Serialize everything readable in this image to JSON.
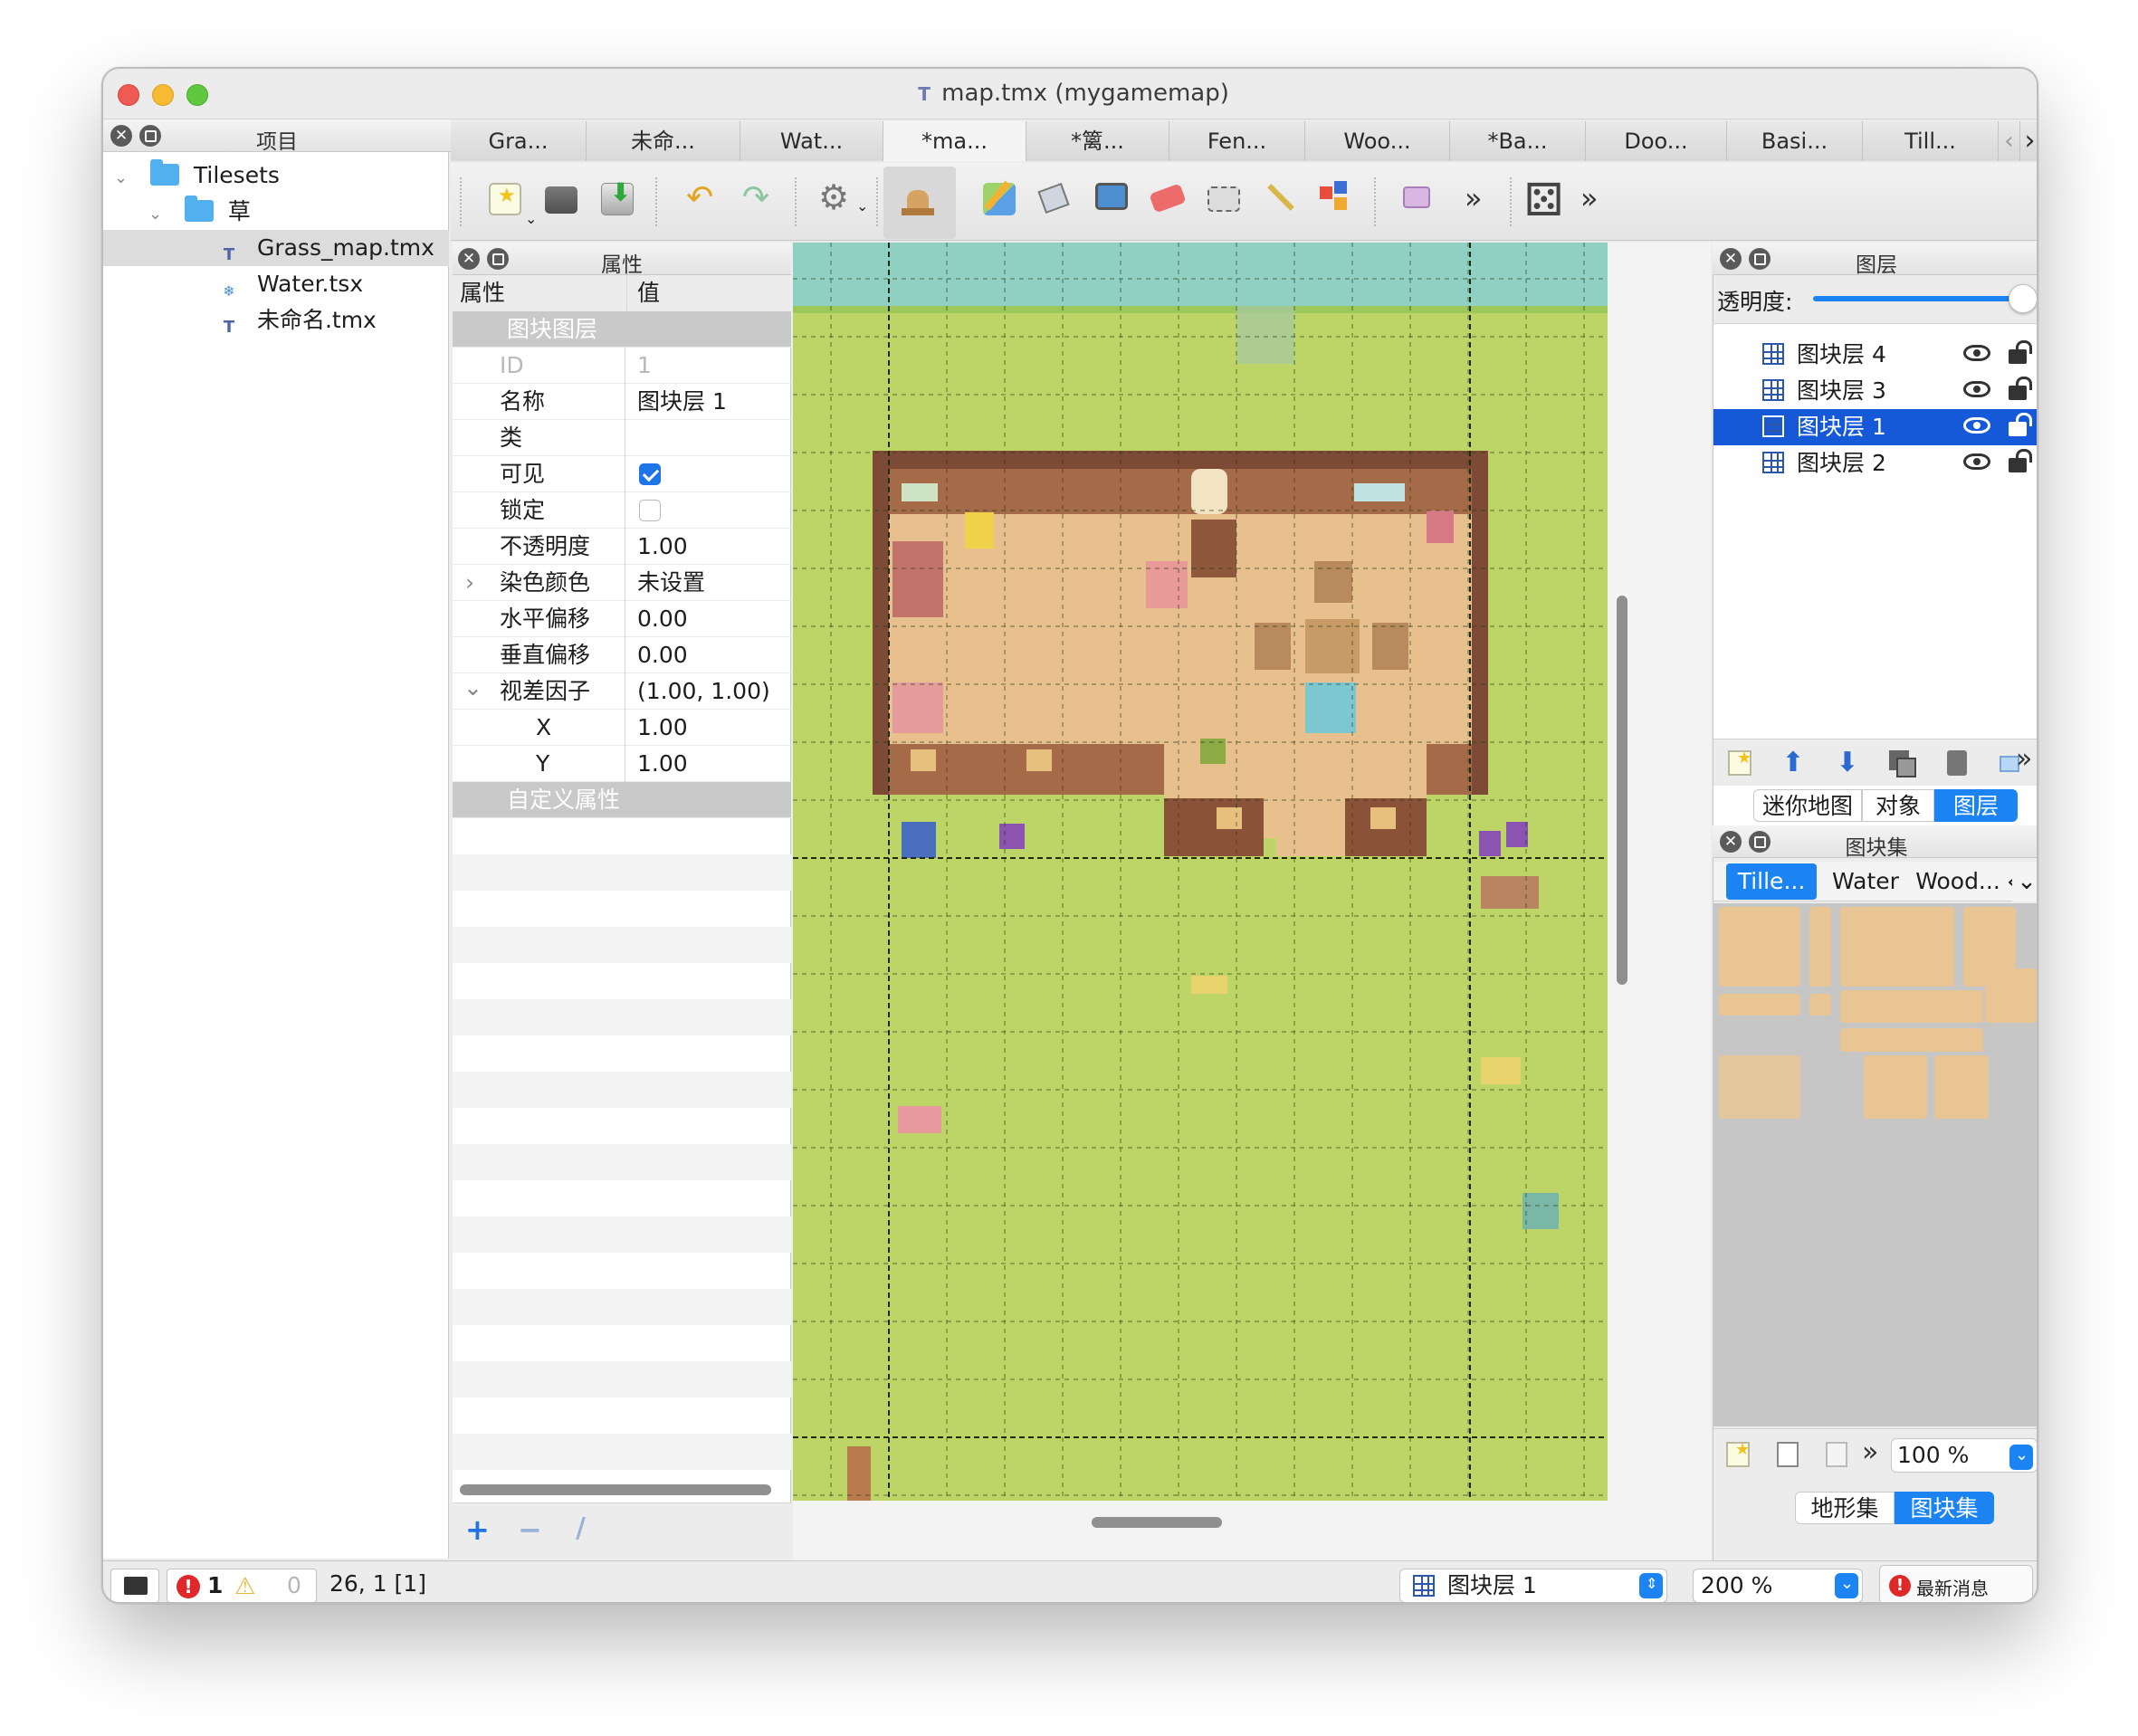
{
  "window": {
    "title": "map.tmx (mygamemap)"
  },
  "project_panel": {
    "title": "项目",
    "items": [
      {
        "label": "Tilesets",
        "kind": "folder"
      },
      {
        "label": "草",
        "kind": "folder"
      },
      {
        "label": "Grass_map.tmx",
        "kind": "tmx",
        "selected": true
      },
      {
        "label": "Water.tsx",
        "kind": "tsx"
      },
      {
        "label": "未命名.tmx",
        "kind": "tmx"
      }
    ]
  },
  "doc_tabs": [
    "Gra...",
    "未命...",
    "Wat...",
    "*ma...",
    "*篱...",
    "Fen...",
    "Woo...",
    "*Ba...",
    "Doo...",
    "Basi...",
    "Till..."
  ],
  "toolbar": {
    "tools": [
      "new-map-icon",
      "open-icon",
      "save-icon",
      "undo-icon",
      "redo-icon",
      "command-gear-icon",
      "stamp-brush-icon",
      "terrain-brush-icon",
      "bucket-fill-icon",
      "shape-fill-icon",
      "eraser-icon",
      "rect-select-icon",
      "magic-wand-icon",
      "select-same-tile-icon",
      "world-tool-icon",
      "more-icon",
      "random-mode-icon",
      "more-icon-2"
    ]
  },
  "properties_panel": {
    "title": "属性",
    "col_key": "属性",
    "col_value": "值",
    "group1": "图块图层",
    "rows": [
      {
        "key": "ID",
        "value": "1",
        "disabled": true
      },
      {
        "key": "名称",
        "value": "图块层 1"
      },
      {
        "key": "类",
        "value": ""
      },
      {
        "key": "可见",
        "value": "",
        "checkbox": true,
        "checked": true
      },
      {
        "key": "锁定",
        "value": "",
        "checkbox": true,
        "checked": false
      },
      {
        "key": "不透明度",
        "value": "1.00"
      },
      {
        "key": "染色颜色",
        "value": "未设置",
        "expander": "›"
      },
      {
        "key": "水平偏移",
        "value": "0.00"
      },
      {
        "key": "垂直偏移",
        "value": "0.00"
      },
      {
        "key": "视差因子",
        "value": "(1.00, 1.00)",
        "expander": "⌄"
      },
      {
        "key": "X",
        "value": "1.00",
        "indent": true
      },
      {
        "key": "Y",
        "value": "1.00",
        "indent": true
      }
    ],
    "group2": "自定义属性",
    "footer": {
      "add": "+",
      "remove": "−",
      "rename": "/"
    }
  },
  "layers_panel": {
    "title": "图层",
    "opacity_label": "透明度:",
    "opacity_value": 1.0,
    "layers": [
      {
        "name": "图块层 4",
        "selected": false
      },
      {
        "name": "图块层 3",
        "selected": false
      },
      {
        "name": "图块层 1",
        "selected": true
      },
      {
        "name": "图块层 2",
        "selected": false
      }
    ],
    "tabs": [
      "迷你地图",
      "对象",
      "图层"
    ],
    "active_tab": "图层"
  },
  "tilesets_panel": {
    "title": "图块集",
    "tabs": [
      "Tille...",
      "Water",
      "Wood..."
    ],
    "active_tab": "Tille...",
    "zoom": "100 %",
    "bottom_tabs": [
      "地形集",
      "图块集"
    ],
    "active_bottom_tab": "图块集"
  },
  "status_bar": {
    "errors": "1",
    "warnings": "0",
    "coords": "26, 1 [1]",
    "layer_select": "图块层 1",
    "zoom_select": "200 %",
    "news": "最新消息"
  },
  "colors": {
    "selection": "#1659d8",
    "accent": "#1b84f2",
    "grass": "#bdd466",
    "water": "#8fd0c3",
    "wood": "#7c4a35",
    "floor": "#e7c08e"
  }
}
